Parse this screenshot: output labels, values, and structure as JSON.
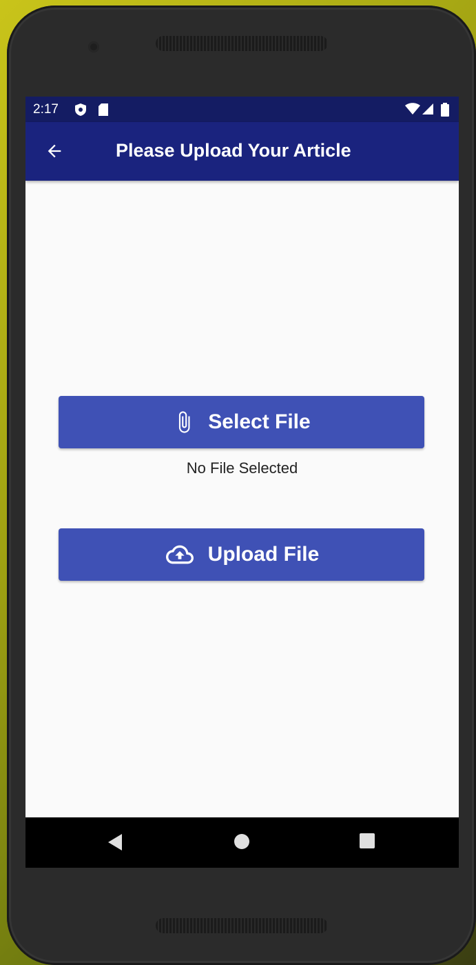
{
  "status_bar": {
    "time": "2:17"
  },
  "app_bar": {
    "title": "Please Upload Your Article"
  },
  "select_button": {
    "label": "Select File"
  },
  "file_status": {
    "text": "No File Selected"
  },
  "upload_button": {
    "label": "Upload File"
  },
  "icons": {
    "back": "arrow-back-icon",
    "select": "paperclip-icon",
    "upload": "cloud-upload-icon",
    "nav_back": "triangle-back-icon",
    "nav_home": "circle-home-icon",
    "nav_recents": "square-recents-icon"
  },
  "colors": {
    "status_bar": "#141c63",
    "app_bar": "#1a237e",
    "button": "#3f51b5",
    "background": "#fafafa"
  }
}
